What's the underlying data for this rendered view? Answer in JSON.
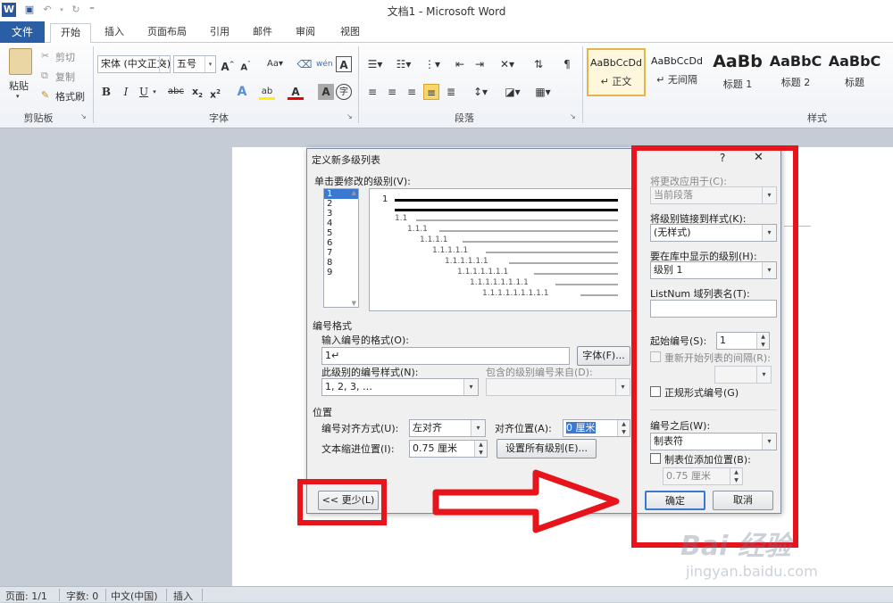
{
  "titlebar": {
    "title": "文档1 - Microsoft Word",
    "word_icon": "W"
  },
  "tabs": {
    "file": "文件",
    "items": [
      "开始",
      "插入",
      "页面布局",
      "引用",
      "邮件",
      "审阅",
      "视图"
    ]
  },
  "ribbon": {
    "clipboard": {
      "paste": "粘贴",
      "cut": "剪切",
      "copy": "复制",
      "format_painter": "格式刷",
      "label": "剪贴板"
    },
    "font": {
      "name": "宋体 (中文正文)",
      "size": "五号",
      "label": "字体"
    },
    "paragraph": {
      "label": "段落"
    },
    "styles": {
      "label": "样式",
      "items": [
        {
          "sample": "AaBbCcDd",
          "name": "正文",
          "prefix": "↵"
        },
        {
          "sample": "AaBbCcDd",
          "name": "无间隔",
          "prefix": "↵"
        },
        {
          "sample": "AaBb",
          "name": "标题 1",
          "prefix": ""
        },
        {
          "sample": "AaBbC",
          "name": "标题 2",
          "prefix": ""
        },
        {
          "sample": "AaBbC",
          "name": "标题",
          "prefix": ""
        }
      ]
    }
  },
  "dialog": {
    "title": "定义新多级列表",
    "help": "?",
    "close": "✕",
    "level_prompt": "单击要修改的级别(V):",
    "levels": [
      "1",
      "2",
      "3",
      "4",
      "5",
      "6",
      "7",
      "8",
      "9"
    ],
    "preview_lines": [
      "1",
      "1.1",
      "1.1.1",
      "1.1.1.1",
      "1.1.1.1.1",
      "1.1.1.1.1.1",
      "1.1.1.1.1.1.1",
      "1.1.1.1.1.1.1.1",
      "1.1.1.1.1.1.1.1.1"
    ],
    "number_format_heading": "编号格式",
    "enter_format_label": "输入编号的格式(O):",
    "enter_format_value": "1↵",
    "font_button": "字体(F)...",
    "number_style_label": "此级别的编号样式(N):",
    "number_style_value": "1, 2, 3, …",
    "include_level_label": "包含的级别编号来自(D):",
    "position_heading": "位置",
    "alignment_label": "编号对齐方式(U):",
    "alignment_value": "左对齐",
    "align_at_label": "对齐位置(A):",
    "align_at_value": "0 厘米",
    "text_indent_label": "文本缩进位置(I):",
    "text_indent_value": "0.75 厘米",
    "set_all_levels_button": "设置所有级别(E)...",
    "less_button": "<< 更少(L)",
    "apply_to_label": "将更改应用于(C):",
    "apply_to_value": "当前段落",
    "link_style_label": "将级别链接到样式(K):",
    "link_style_value": "(无样式)",
    "gallery_level_label": "要在库中显示的级别(H):",
    "gallery_level_value": "级别 1",
    "listnum_label": "ListNum 域列表名(T):",
    "listnum_value": "",
    "start_at_label": "起始编号(S):",
    "start_at_value": "1",
    "restart_label": "重新开始列表的间隔(R):",
    "legal_label": "正规形式编号(G)",
    "follow_label": "编号之后(W):",
    "follow_value": "制表符",
    "tab_stop_label": "制表位添加位置(B):",
    "tab_stop_value": "0.75 厘米",
    "ok_button": "确定",
    "cancel_button": "取消"
  },
  "statusbar": {
    "page": "页面: 1/1",
    "words": "字数: 0",
    "language": "中文(中国)",
    "mode": "插入"
  },
  "watermark": {
    "text": "Bai 经验",
    "url": "jingyan.baidu.com"
  },
  "colors": {
    "file_tab": "#2a5fa6",
    "annotation_red": "#e8141c",
    "selection": "#3b79d1"
  }
}
